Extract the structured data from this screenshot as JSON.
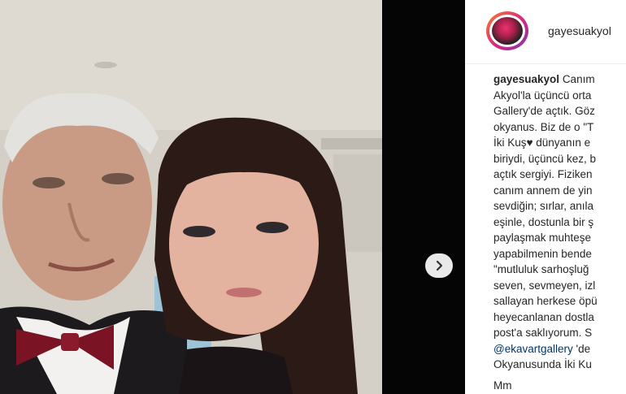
{
  "post": {
    "username": "gayesuakyol",
    "caption_user": "gayesuakyol",
    "caption_lines": [
      "Canım",
      "Akyol'la üçüncü orta",
      "Gallery'de açtık. Göz",
      "okyanus. Biz de o \"T",
      "İki Kuş♥ dünyanın e",
      "biriydi, üçüncü kez, b",
      "açtık sergiyi. Fiziken",
      "canım annem de yin",
      "sevdiğin; sırlar, anıla",
      "eşinle, dostunla bir ş",
      "paylaşmak muhteşe",
      "yapabilmenin bende",
      "\"mutluluk sarhoşluğ",
      "seven, sevmeyen, izl",
      "sallayan herkese öpü",
      "heyecanlanan dostla",
      "post'a saklıyorum. S"
    ],
    "mention": "@ekavartgallery",
    "mention_after": " 'de",
    "last_line": "Okyanusunda İki Ku",
    "trailing_line": "Mm"
  },
  "icons": {
    "next": "chevron-right-icon",
    "avatar": "profile-avatar"
  },
  "colors": {
    "text": "#262626",
    "mention": "#003569",
    "gap": "#050505"
  }
}
